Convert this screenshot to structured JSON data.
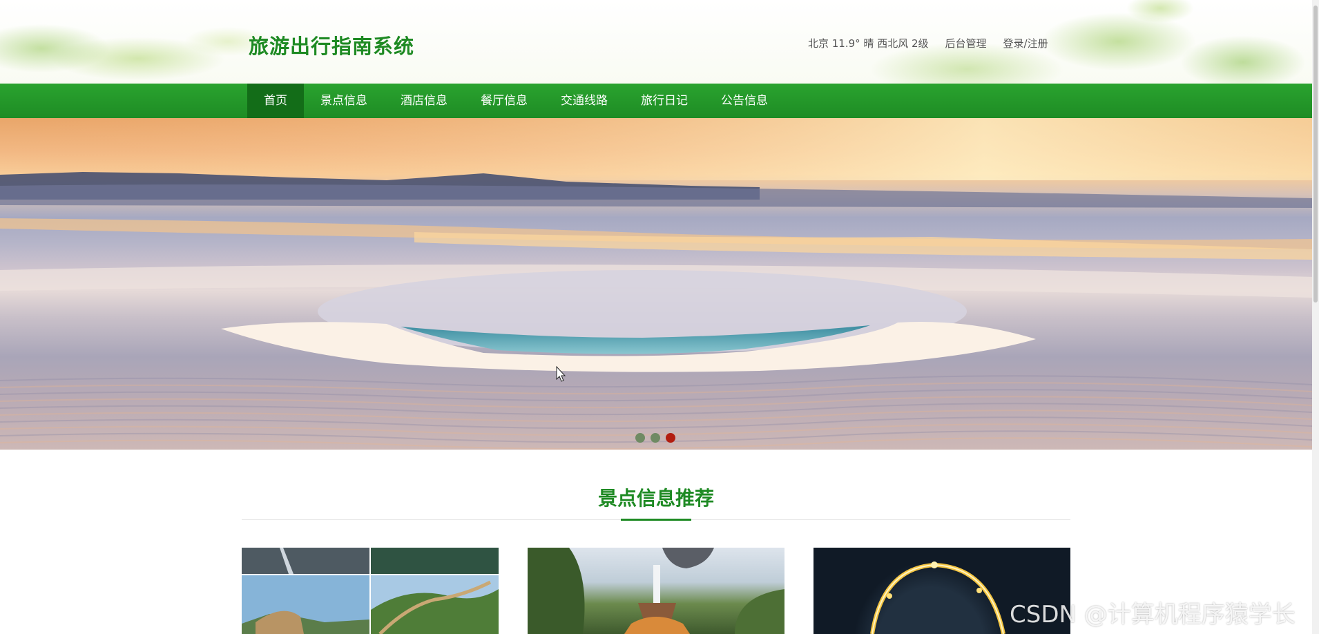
{
  "header": {
    "site_title": "旅游出行指南系统",
    "weather": "北京  11.9°  晴  西北风  2级",
    "admin_link": "后台管理",
    "login_link": "登录/注册"
  },
  "nav": {
    "items": [
      {
        "label": "首页",
        "active": true
      },
      {
        "label": "景点信息",
        "active": false
      },
      {
        "label": "酒店信息",
        "active": false
      },
      {
        "label": "餐厅信息",
        "active": false
      },
      {
        "label": "交通线路",
        "active": false
      },
      {
        "label": "旅行日记",
        "active": false
      },
      {
        "label": "公告信息",
        "active": false
      }
    ]
  },
  "banner": {
    "slide_count": 3,
    "active_slide": 3
  },
  "section": {
    "title": "景点信息推荐"
  },
  "watermark": "CSDN @计算机程序猿学长",
  "colors": {
    "brand_green": "#1e8a23",
    "nav_green": "#24992a",
    "nav_active": "#136d18",
    "dot_active": "#b21d10"
  }
}
